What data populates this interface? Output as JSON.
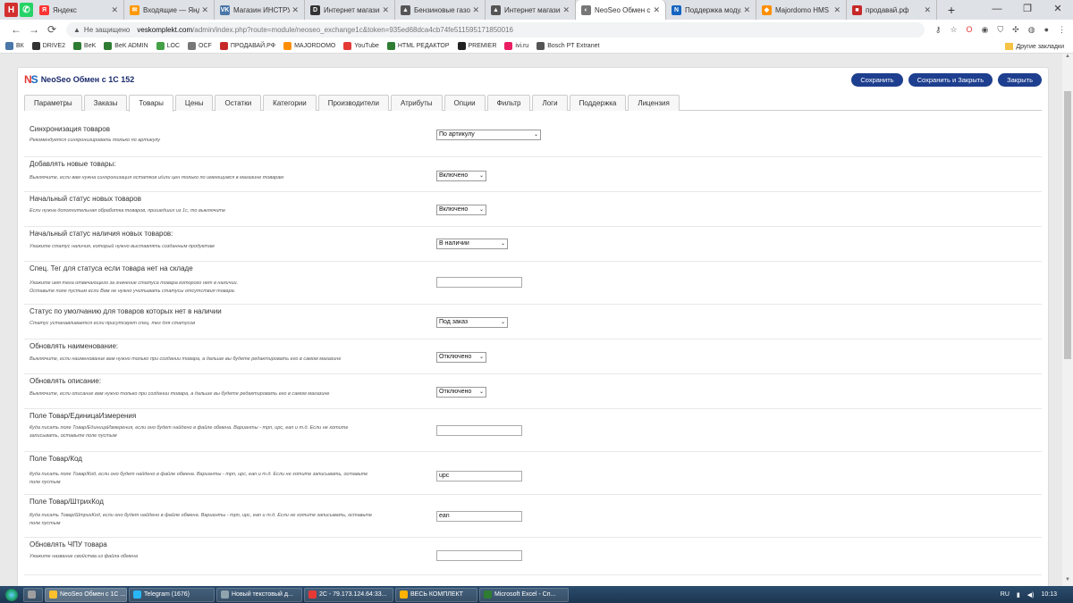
{
  "browser": {
    "pinned_tabs": [
      {
        "name": "pinned-tab-hh",
        "glyph": "H",
        "color": "#d32f2f"
      },
      {
        "name": "pinned-tab-whatsapp",
        "glyph": "✆",
        "color": "#25d366"
      }
    ],
    "tabs": [
      {
        "title": "Яндекс",
        "icon": "Я",
        "color": "#ff3333"
      },
      {
        "title": "Входящие — Янд...",
        "icon": "✉",
        "color": "#ff9800"
      },
      {
        "title": "Магазин ИНСТРУ...",
        "icon": "VK",
        "color": "#4a76a8"
      },
      {
        "title": "Интернет магазин...",
        "icon": "D",
        "color": "#333333"
      },
      {
        "title": "Бензиновые газо...",
        "icon": "▲",
        "color": "#555555"
      },
      {
        "title": "Интернет магазин...",
        "icon": "▲",
        "color": "#555555"
      },
      {
        "title": "NeoSeo Обмен с 1...",
        "icon": "◐",
        "color": "#777777",
        "active": true
      },
      {
        "title": "Поддержка моду...",
        "icon": "N",
        "color": "#1565c0"
      },
      {
        "title": "Majordomo HMS",
        "icon": "◆",
        "color": "#ff8f00"
      },
      {
        "title": "продавай.рф",
        "icon": "■",
        "color": "#c62828"
      }
    ],
    "new_tab_label": "+",
    "window_controls": [
      "—",
      "❐",
      "✕"
    ],
    "address": {
      "security_label": "Не защищено",
      "host": "veskomplekt.com",
      "path": "/admin/index.php?route=module/neoseo_exchange1c&token=935ed68dca4cb74fe511595171850016"
    },
    "bookmarks": [
      {
        "label": "ВК",
        "color": "#4a76a8"
      },
      {
        "label": "DRIVE2",
        "color": "#333333"
      },
      {
        "label": "BeK",
        "color": "#2e7d32"
      },
      {
        "label": "BeK ADMIN",
        "color": "#2e7d32"
      },
      {
        "label": "LOC",
        "color": "#43a047"
      },
      {
        "label": "OCF",
        "color": "#777777"
      },
      {
        "label": "ПРОДАВАЙ.РФ",
        "color": "#c62828"
      },
      {
        "label": "MAJORDOMO",
        "color": "#ff8f00"
      },
      {
        "label": "YouTube",
        "color": "#e53935"
      },
      {
        "label": "HTML РЕДАКТОР",
        "color": "#2e7d32"
      },
      {
        "label": "PREMIER",
        "color": "#222222"
      },
      {
        "label": "ivi.ru",
        "color": "#e91e63"
      },
      {
        "label": "Bosch PT Extranet",
        "color": "#555555"
      }
    ],
    "other_bookmarks": "Другие закладки"
  },
  "module": {
    "logo_n": "N",
    "logo_s": "S",
    "title": "NeoSeo Обмен с 1С 152",
    "buttons": {
      "save": "Сохранить",
      "save_close": "Сохранить и Закрыть",
      "close": "Закрыть"
    },
    "tabs": [
      "Параметры",
      "Заказы",
      "Товары",
      "Цены",
      "Остатки",
      "Категории",
      "Производители",
      "Атрибуты",
      "Опции",
      "Фильтр",
      "Логи",
      "Поддержка",
      "Лицензия"
    ],
    "active_tab": "Товары"
  },
  "settings": [
    {
      "label": "Синхронизация товаров",
      "help": "Рекомендуется синхронизировать только по артикулу",
      "control": "select",
      "value": "По артикулу"
    },
    {
      "label": "Добавлять новые товары:",
      "help": "Выключите, если вам нужна синхронизация остатков и/или цен только по имеющимся в магазине товарам",
      "control": "select",
      "value": "Включено"
    },
    {
      "label": "Начальный статус новых товаров",
      "help": "Если нужна дополнительная обработка товаров, пришедших из 1с, то выключите",
      "control": "select",
      "value": "Включено"
    },
    {
      "label": "Начальный статус наличия новых товаров:",
      "help": "Укажите статус наличия, который нужно выставлять созданным продуктам",
      "control": "select",
      "value": "В наличии"
    },
    {
      "label": "Спец. Тег для статуса если товара нет на складе",
      "help": "Укажите имя тега отвечающего за значение статуса товара которого нет в наличии.\nОставьте поле пустым если Вам не нужно учитывать статусы отсутствия товара.",
      "control": "input",
      "value": ""
    },
    {
      "label": "Статус по умолчанию для товаров которых нет в наличии",
      "help": "Статус устанавливается если присутсвует спец. тег для статусов",
      "control": "select",
      "value": "Под заказ"
    },
    {
      "label": "Обновлять наименование:",
      "help": "Выключите, если наименование вам нужно только при создании товара, а дальше вы будете редактировать его в самом магазине",
      "control": "select",
      "value": "Отключено"
    },
    {
      "label": "Обновлять описание:",
      "help": "Выключите, если описание вам нужно только при создании товара, а дальше вы будете редактировать его в самом магазине",
      "control": "select",
      "value": "Отключено"
    },
    {
      "label": "Поле Товар/ЕдиницаИзмерения",
      "help": "Куда писать поле Товар/ЕдиницаИзмерения, если оно будет найдено в файле обмена. Варианты - mpn, upc, ean и т.д. Если не хотите\nзаписывать, оставьте поле пустым",
      "control": "input",
      "value": ""
    },
    {
      "label": "Поле Товар/Код",
      "help": "Куда писать поле Товар/Код, если оно будет найдено в файле обмена. Варианты - mpn, upc, ean и т.д. Если не хотите записывать, оставьте\nполе пустым",
      "control": "input",
      "value": "upc"
    },
    {
      "label": "Поле Товар/ШтрихКод",
      "help": "Куда писать Товар/ШтрихКод, если оно будет найдено в файле обмена. Варианты - mpn, upc, ean и т.д. Если не хотите записывать, оставьте\nполе пустым",
      "control": "input",
      "value": "ean"
    },
    {
      "label": "Обновлять ЧПУ товара",
      "help": "Укажите название свойства из файла обмена",
      "control": "input",
      "value": ""
    }
  ],
  "taskbar": {
    "items": [
      {
        "label": "",
        "color": "#9e9e9e",
        "small": true
      },
      {
        "label": "NeoSeo Обмен с 1С ...",
        "color": "#fbc02d",
        "active": true
      },
      {
        "label": "Telegram (1676)",
        "color": "#29b6f6"
      },
      {
        "label": "Новый текстовый д...",
        "color": "#90a4ae"
      },
      {
        "label": "2С - 79.173.124.64:33...",
        "color": "#e53935"
      },
      {
        "label": "ВЕСЬ КОМПЛЕКТ",
        "color": "#ffb300"
      },
      {
        "label": "Microsoft Excel - Сп...",
        "color": "#2e7d32"
      }
    ],
    "lang": "RU",
    "time": "10:13"
  }
}
